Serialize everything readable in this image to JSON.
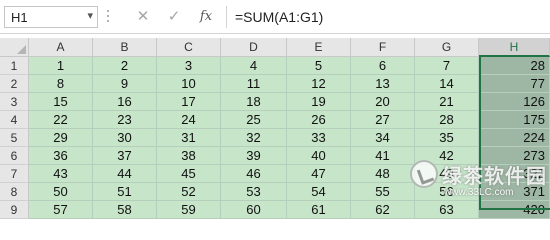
{
  "name_box": {
    "value": "H1",
    "dropdown_icon": "chevron-down-icon"
  },
  "formula_bar": {
    "cancel_icon": "close-icon",
    "enter_icon": "check-icon",
    "function_label": "fx",
    "formula": "=SUM(A1:G1)"
  },
  "sheet": {
    "columns": [
      "A",
      "B",
      "C",
      "D",
      "E",
      "F",
      "G",
      "H"
    ],
    "selected_column": "H",
    "rows": [
      {
        "label": "1",
        "cells": [
          "1",
          "2",
          "3",
          "4",
          "5",
          "6",
          "7",
          "28"
        ]
      },
      {
        "label": "2",
        "cells": [
          "8",
          "9",
          "10",
          "11",
          "12",
          "13",
          "14",
          "77"
        ]
      },
      {
        "label": "3",
        "cells": [
          "15",
          "16",
          "17",
          "18",
          "19",
          "20",
          "21",
          "126"
        ]
      },
      {
        "label": "4",
        "cells": [
          "22",
          "23",
          "24",
          "25",
          "26",
          "27",
          "28",
          "175"
        ]
      },
      {
        "label": "5",
        "cells": [
          "29",
          "30",
          "31",
          "32",
          "33",
          "34",
          "35",
          "224"
        ]
      },
      {
        "label": "6",
        "cells": [
          "36",
          "37",
          "38",
          "39",
          "40",
          "41",
          "42",
          "273"
        ]
      },
      {
        "label": "7",
        "cells": [
          "43",
          "44",
          "45",
          "46",
          "47",
          "48",
          "49",
          "322"
        ]
      },
      {
        "label": "8",
        "cells": [
          "50",
          "51",
          "52",
          "53",
          "54",
          "55",
          "56",
          "371"
        ]
      },
      {
        "label": "9",
        "cells": [
          "57",
          "58",
          "59",
          "60",
          "61",
          "62",
          "63",
          "420"
        ]
      }
    ]
  },
  "watermark": {
    "brand": "绿茶软件园",
    "url": "www.33LC.com"
  },
  "colors": {
    "selection_fill": "#c6e5c9",
    "selected_column_fill": "#9db7a4",
    "accent": "#217346"
  }
}
